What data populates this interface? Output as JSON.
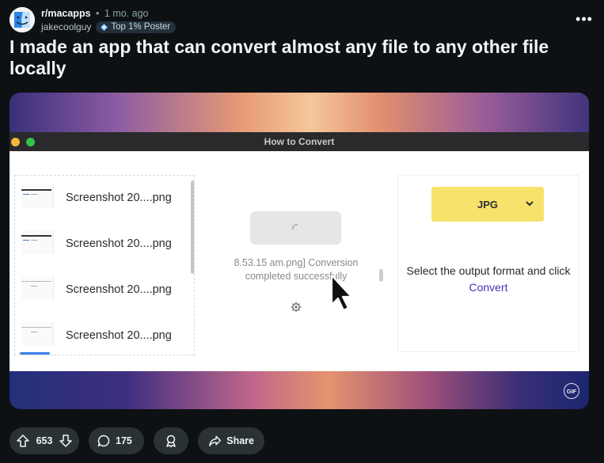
{
  "post": {
    "subreddit": "r/macapps",
    "separator": "•",
    "age": "1 mo. ago",
    "author": "jakecoolguy",
    "flair": "Top 1% Poster",
    "more_label": "•••",
    "title": "I made an app that can convert almost any file to any other file locally"
  },
  "app_window": {
    "title": "How to Convert",
    "files": [
      {
        "name": "Screenshot 20....png"
      },
      {
        "name": "Screenshot 20....png"
      },
      {
        "name": "Screenshot 20....png"
      },
      {
        "name": "Screenshot 20....png"
      }
    ],
    "status_line1": "8.53.15 am.png] Conversion",
    "status_line2": "completed successfully",
    "output_format": "JPG",
    "hint_prefix": "Select the output format and click",
    "hint_link": "Convert"
  },
  "media_badge": "GIF",
  "actions": {
    "upvotes": "653",
    "comments": "175",
    "share_label": "Share"
  },
  "icons": [
    "finder-avatar-icon",
    "flair-badge-icon",
    "upvote-icon",
    "downvote-icon",
    "comment-icon",
    "award-icon",
    "share-icon",
    "settings-icon",
    "chevron-down-icon",
    "spinner-icon",
    "cursor-icon"
  ]
}
